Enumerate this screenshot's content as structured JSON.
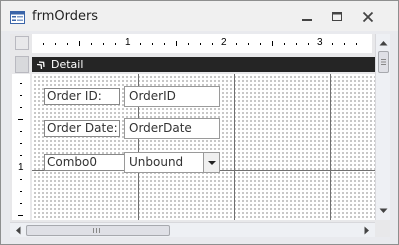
{
  "window": {
    "title": "frmOrders"
  },
  "ruler": {
    "horizontal_numbers": [
      "1",
      "2",
      "3"
    ],
    "vertical_numbers": [
      "1"
    ]
  },
  "section": {
    "label": "Detail"
  },
  "controls": {
    "order_id_label": "Order ID:",
    "order_id_field": "OrderID",
    "order_date_label": "Order Date:",
    "order_date_field": "OrderDate",
    "combo_label": "Combo0",
    "combo_field": "Unbound"
  },
  "icons": {
    "app": "form-icon",
    "minimize": "minimize-icon",
    "maximize": "maximize-icon",
    "close": "close-icon",
    "section": "section-collapse-icon",
    "dropdown": "chevron-down-icon"
  },
  "colors": {
    "section_bar": "#252525",
    "window_frame": "#e9eaee",
    "grid_line": "#6f6f6f"
  }
}
